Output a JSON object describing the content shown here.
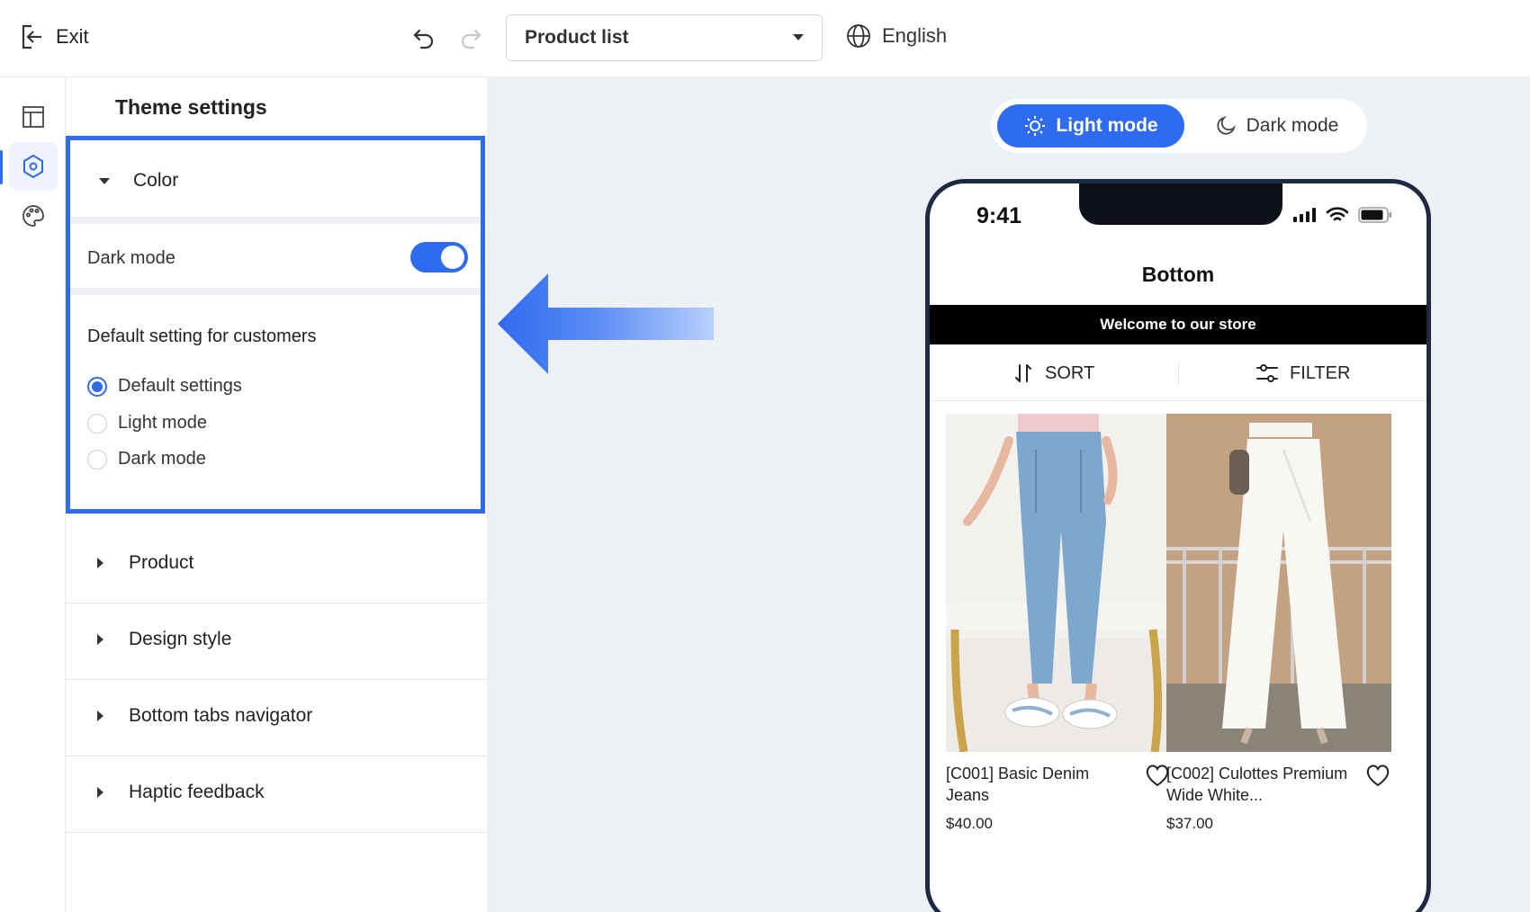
{
  "topbar": {
    "exit_label": "Exit",
    "page_select_value": "Product list",
    "language": "English"
  },
  "panel": {
    "title": "Theme settings",
    "color_section": {
      "label": "Color",
      "dark_mode_label": "Dark mode",
      "dark_mode_enabled": true,
      "default_setting_title": "Default setting for customers",
      "options": [
        "Default settings",
        "Light mode",
        "Dark mode"
      ],
      "selected_option": "Default settings"
    },
    "sections": [
      "Product",
      "Design style",
      "Bottom tabs navigator",
      "Haptic feedback"
    ]
  },
  "preview": {
    "mode_toggle": {
      "light_label": "Light mode",
      "dark_label": "Dark mode",
      "active": "Light mode"
    },
    "phone": {
      "time": "9:41",
      "title": "Bottom",
      "banner": "Welcome to our store",
      "sort_label": "SORT",
      "filter_label": "FILTER",
      "products": [
        {
          "name": "[C001] Basic Denim Jeans",
          "price": "$40.00"
        },
        {
          "name": "[C002] Culottes Premium Wide White...",
          "price": "$37.00"
        }
      ]
    }
  },
  "colors": {
    "accent": "#2f6bf0",
    "canvas_bg": "#edf0f4",
    "phone_frame": "#1d2a44"
  }
}
